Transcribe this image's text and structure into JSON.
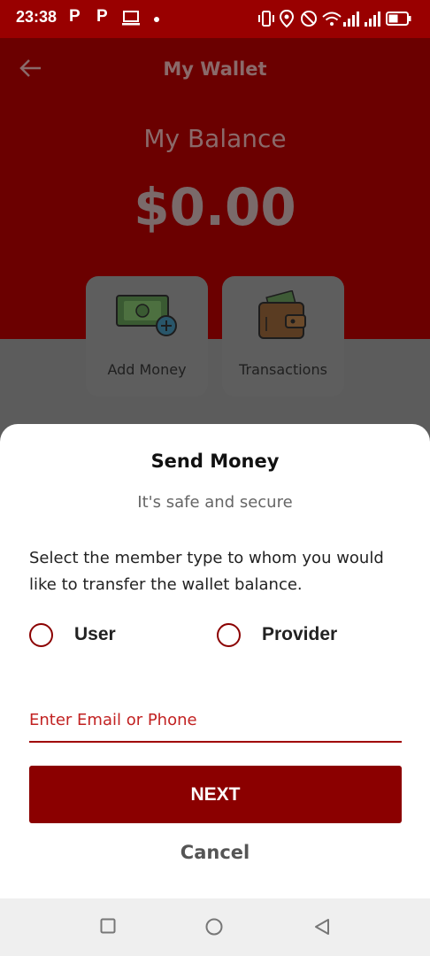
{
  "status_bar": {
    "time": "23:38",
    "left_icons": [
      "P",
      "P"
    ],
    "icons": [
      "laptop-icon",
      "notification-dot",
      "vibrate-icon",
      "location-icon",
      "dnd-icon",
      "wifi-icon",
      "signal-icon",
      "signal-icon",
      "battery-icon"
    ]
  },
  "wallet": {
    "title": "My Wallet",
    "balance_label": "My Balance",
    "balance_value": "$0.00",
    "actions": [
      {
        "label": "Add Money",
        "icon": "add-money-icon"
      },
      {
        "label": "Transactions",
        "icon": "wallet-icon"
      }
    ]
  },
  "send_money": {
    "title": "Send Money",
    "subtitle": "It's safe and secure",
    "instruction": "Select the member type to whom you would like to transfer the wallet balance.",
    "options": [
      {
        "label": "User",
        "selected": false
      },
      {
        "label": "Provider",
        "selected": false
      }
    ],
    "input": {
      "value": "",
      "placeholder": "Enter Email or Phone"
    },
    "next_label": "NEXT",
    "cancel_label": "Cancel"
  },
  "nav_bar": {
    "buttons": [
      "recent-apps-icon",
      "home-icon",
      "back-icon"
    ]
  },
  "colors": {
    "brand": "#8b0000",
    "status_bar": "#990000"
  }
}
